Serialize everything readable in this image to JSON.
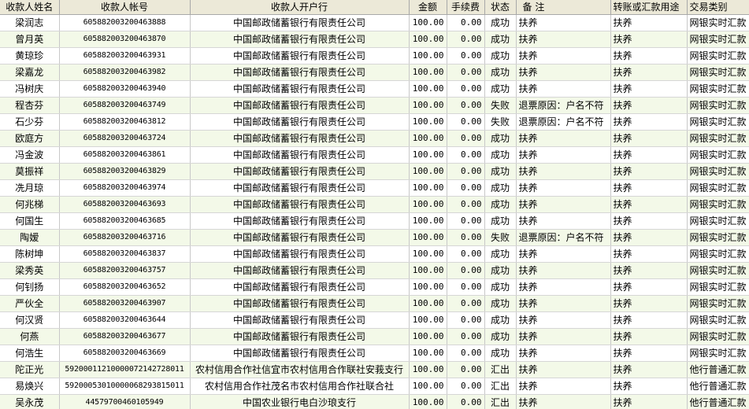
{
  "columns": [
    "收款人姓名",
    "收款人帐号",
    "收款人开户行",
    "金额",
    "手续费",
    "状态",
    "备  注",
    "转账或汇款用途",
    "交易类别"
  ],
  "rows": [
    [
      "梁润志",
      "605882003200463888",
      "中国邮政储蓄银行有限责任公司",
      "100.00",
      "0.00",
      "成功",
      "扶养",
      "扶养",
      "网银实时汇款"
    ],
    [
      "曾月英",
      "605882003200463870",
      "中国邮政储蓄银行有限责任公司",
      "100.00",
      "0.00",
      "成功",
      "扶养",
      "扶养",
      "网银实时汇款"
    ],
    [
      "黄琼珍",
      "605882003200463931",
      "中国邮政储蓄银行有限责任公司",
      "100.00",
      "0.00",
      "成功",
      "扶养",
      "扶养",
      "网银实时汇款"
    ],
    [
      "梁嘉龙",
      "605882003200463982",
      "中国邮政储蓄银行有限责任公司",
      "100.00",
      "0.00",
      "成功",
      "扶养",
      "扶养",
      "网银实时汇款"
    ],
    [
      "冯树庆",
      "605882003200463940",
      "中国邮政储蓄银行有限责任公司",
      "100.00",
      "0.00",
      "成功",
      "扶养",
      "扶养",
      "网银实时汇款"
    ],
    [
      "程杏芬",
      "605882003200463749",
      "中国邮政储蓄银行有限责任公司",
      "100.00",
      "0.00",
      "失败",
      "退票原因：户名不符",
      "扶养",
      "网银实时汇款"
    ],
    [
      "石少芬",
      "605882003200463812",
      "中国邮政储蓄银行有限责任公司",
      "100.00",
      "0.00",
      "失败",
      "退票原因：户名不符",
      "扶养",
      "网银实时汇款"
    ],
    [
      "欧庭方",
      "605882003200463724",
      "中国邮政储蓄银行有限责任公司",
      "100.00",
      "0.00",
      "成功",
      "扶养",
      "扶养",
      "网银实时汇款"
    ],
    [
      "冯金波",
      "605882003200463861",
      "中国邮政储蓄银行有限责任公司",
      "100.00",
      "0.00",
      "成功",
      "扶养",
      "扶养",
      "网银实时汇款"
    ],
    [
      "莫振祥",
      "605882003200463829",
      "中国邮政储蓄银行有限责任公司",
      "100.00",
      "0.00",
      "成功",
      "扶养",
      "扶养",
      "网银实时汇款"
    ],
    [
      "冼月琼",
      "605882003200463974",
      "中国邮政储蓄银行有限责任公司",
      "100.00",
      "0.00",
      "成功",
      "扶养",
      "扶养",
      "网银实时汇款"
    ],
    [
      "何兆梯",
      "605882003200463693",
      "中国邮政储蓄银行有限责任公司",
      "100.00",
      "0.00",
      "成功",
      "扶养",
      "扶养",
      "网银实时汇款"
    ],
    [
      "何国生",
      "605882003200463685",
      "中国邮政储蓄银行有限责任公司",
      "100.00",
      "0.00",
      "成功",
      "扶养",
      "扶养",
      "网银实时汇款"
    ],
    [
      "陶嫒",
      "605882003200463716",
      "中国邮政储蓄银行有限责任公司",
      "100.00",
      "0.00",
      "失败",
      "退票原因：户名不符",
      "扶养",
      "网银实时汇款"
    ],
    [
      "陈树坤",
      "605882003200463837",
      "中国邮政储蓄银行有限责任公司",
      "100.00",
      "0.00",
      "成功",
      "扶养",
      "扶养",
      "网银实时汇款"
    ],
    [
      "梁秀英",
      "605882003200463757",
      "中国邮政储蓄银行有限责任公司",
      "100.00",
      "0.00",
      "成功",
      "扶养",
      "扶养",
      "网银实时汇款"
    ],
    [
      "何钊扬",
      "605882003200463652",
      "中国邮政储蓄银行有限责任公司",
      "100.00",
      "0.00",
      "成功",
      "扶养",
      "扶养",
      "网银实时汇款"
    ],
    [
      "严伙全",
      "605882003200463907",
      "中国邮政储蓄银行有限责任公司",
      "100.00",
      "0.00",
      "成功",
      "扶养",
      "扶养",
      "网银实时汇款"
    ],
    [
      "何汉贤",
      "605882003200463644",
      "中国邮政储蓄银行有限责任公司",
      "100.00",
      "0.00",
      "成功",
      "扶养",
      "扶养",
      "网银实时汇款"
    ],
    [
      "何燕",
      "605882003200463677",
      "中国邮政储蓄银行有限责任公司",
      "100.00",
      "0.00",
      "成功",
      "扶养",
      "扶养",
      "网银实时汇款"
    ],
    [
      "何浩生",
      "605882003200463669",
      "中国邮政储蓄银行有限责任公司",
      "100.00",
      "0.00",
      "成功",
      "扶养",
      "扶养",
      "网银实时汇款"
    ],
    [
      "陀正光",
      "592000112100000721427280​11",
      "农村信用合作社信宜市农村信用合作联社安莪支行",
      "100.00",
      "0.00",
      "汇出",
      "扶养",
      "扶养",
      "他行普通汇款"
    ],
    [
      "易焕兴",
      "592000530100000682938150​11",
      "农村信用合作社茂名市农村信用合作社联合社",
      "100.00",
      "0.00",
      "汇出",
      "扶养",
      "扶养",
      "他行普通汇款"
    ],
    [
      "吴永茂",
      "44579700460105949",
      "中国农业银行电白沙琅支行",
      "100.00",
      "0.00",
      "汇出",
      "扶养",
      "扶养",
      "他行普通汇款"
    ]
  ]
}
